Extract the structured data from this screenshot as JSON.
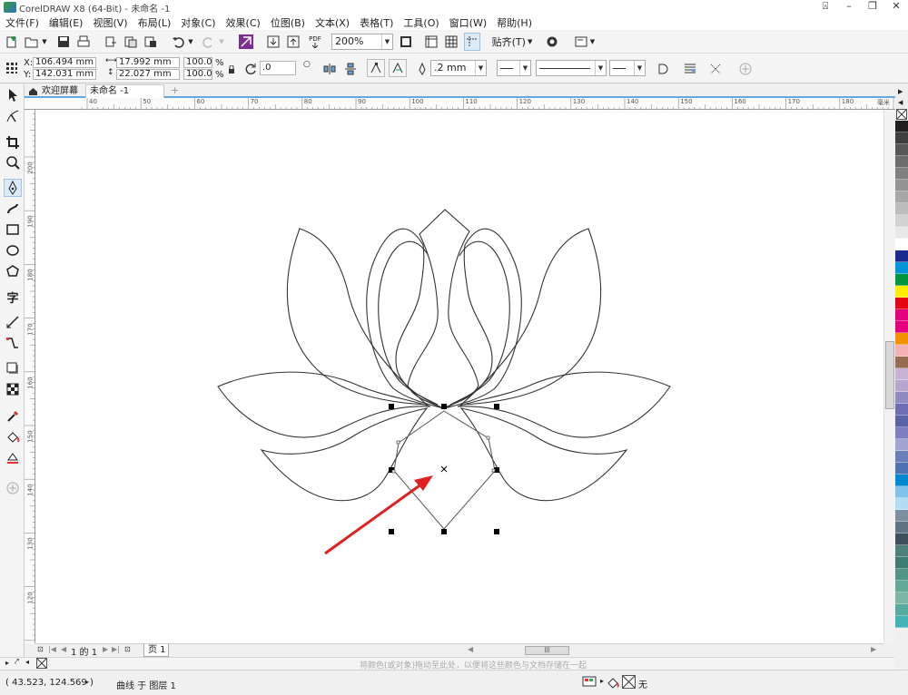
{
  "app": {
    "title": "CorelDRAW X8 (64-Bit) - 未命名 -1"
  },
  "menu": [
    "文件(F)",
    "编辑(E)",
    "视图(V)",
    "布局(L)",
    "对象(C)",
    "效果(C)",
    "位图(B)",
    "文本(X)",
    "表格(T)",
    "工具(O)",
    "窗口(W)",
    "帮助(H)"
  ],
  "toolbar": {
    "pdf_label": "PDF",
    "zoom_value": "200%",
    "snap_label": "贴齐(T)"
  },
  "property_bar": {
    "x_label": "X:",
    "x_value": "106.494 mm",
    "y_label": "Y:",
    "y_value": "142.031 mm",
    "width_value": "17.992 mm",
    "height_value": "22.027 mm",
    "scale_w": "100.0",
    "scale_h": "100.0",
    "percent": "%",
    "rotation": ".0",
    "outline_width": ".2 mm"
  },
  "tabs": {
    "welcome": "欢迎屏幕",
    "document": "未命名 -1"
  },
  "ruler": {
    "h_ticks": [
      "40",
      "50",
      "60",
      "70",
      "80",
      "90",
      "100",
      "110",
      "120",
      "130",
      "140",
      "150",
      "160",
      "170",
      "180"
    ],
    "units": "毫米",
    "v_ticks": [
      "200",
      "190",
      "180",
      "170",
      "160",
      "150",
      "140",
      "130",
      "120"
    ]
  },
  "page_nav": {
    "page_count": "1 的 1",
    "page_tab": "页 1"
  },
  "hint": "将颜色(或对象)拖动至此处，以便将这些颜色与文档存储在一起",
  "status": {
    "cursor": "( 43.523, 124.569 )",
    "object_info": "曲线 于 图层 1",
    "fill_none": "无"
  },
  "colors": {
    "accent": "#62a8e0",
    "arrow": "#e02020",
    "outline": "#333333"
  },
  "palette": [
    "#231f20",
    "#3f3f3f",
    "#585858",
    "#6d6d6d",
    "#808080",
    "#949494",
    "#a7a7a7",
    "#bcbcbc",
    "#d2d2d2",
    "#e8e8e8",
    "#ffffff",
    "#1b2a8f",
    "#0095d8",
    "#009640",
    "#ffed00",
    "#e30613",
    "#e4007f",
    "#e6007e",
    "#f39200",
    "#f5b2b5",
    "#956c4f",
    "#c8b3d7",
    "#b6a6cf",
    "#8f8bc2",
    "#6d6db3",
    "#5a63a8",
    "#7d7fc0",
    "#a3a4d2",
    "#6a7fb9",
    "#4f72b2",
    "#0089cf",
    "#7fc3ea",
    "#b2dcf3",
    "#7b8fa1",
    "#5e7384",
    "#3e4f5c",
    "#4e7f7a",
    "#3e7d73",
    "#509586",
    "#62a897",
    "#7cb6a4",
    "#56aaa0",
    "#43b3b8"
  ]
}
